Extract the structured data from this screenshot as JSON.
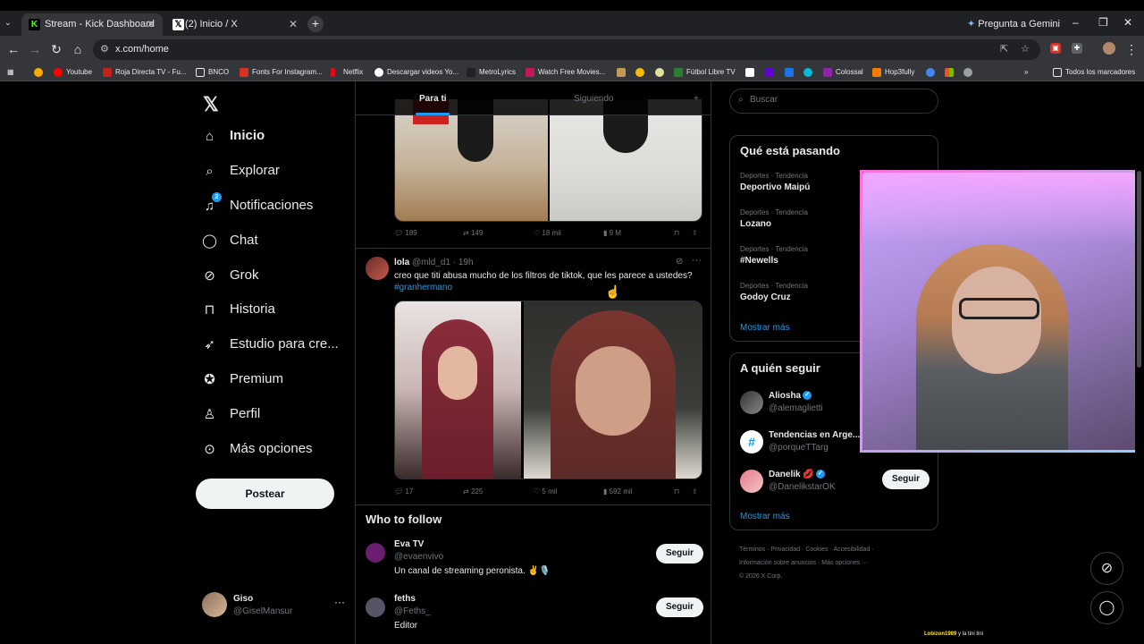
{
  "browser": {
    "tab_menu_icon": "chevron-down-icon",
    "tabs": [
      {
        "title": "Stream - Kick Dashboard",
        "icon": "K",
        "icon_color": "#53fc18",
        "close": "✕"
      },
      {
        "title": "(2) Inicio / X",
        "icon": "𝕏",
        "icon_color": "#000000",
        "close": "✕"
      }
    ],
    "new_tab": "+",
    "gemini": "Pregunta a Gemini",
    "window_controls": [
      "–",
      "❐",
      "✕"
    ],
    "url": "x.com/home",
    "bookmarks": [
      "Youtube",
      "Roja Directa TV - Fu...",
      "BNCO",
      "Fonts For Instagram...",
      "Netflix",
      "Descargar videos Yo...",
      "MetroLyrics",
      "Watch Free Movies...",
      "Fútbol Libre TV",
      "Colossal",
      "Hop3fully"
    ],
    "bookmarks_more": "»",
    "all_bookmarks": "Todos los marcadores"
  },
  "nav": {
    "logo": "𝕏",
    "items": [
      {
        "label": "Inicio",
        "icon": "home-icon"
      },
      {
        "label": "Explorar",
        "icon": "search-icon"
      },
      {
        "label": "Notificaciones",
        "icon": "bell-icon",
        "badge": "2"
      },
      {
        "label": "Chat",
        "icon": "chat-icon"
      },
      {
        "label": "Grok",
        "icon": "grok-icon"
      },
      {
        "label": "Historia",
        "icon": "bookmark-icon"
      },
      {
        "label": "Estudio para cre...",
        "icon": "rocket-icon"
      },
      {
        "label": "Premium",
        "icon": "verified-icon"
      },
      {
        "label": "Perfil",
        "icon": "person-icon"
      },
      {
        "label": "Más opciones",
        "icon": "more-circle-icon"
      }
    ],
    "post_button": "Postear",
    "account": {
      "name": "Giso",
      "handle": "@GiselMansur",
      "more": "···"
    }
  },
  "timeline": {
    "tabs": {
      "for_you": "Para ti",
      "following": "Siguiendo",
      "plus": "+"
    },
    "tweet1": {
      "replies": "189",
      "retweets": "149",
      "likes": "18 mil",
      "views": "9 M"
    },
    "tweet2": {
      "name": "lola",
      "handle": "@mld_d1",
      "time": "· 19h",
      "text": "creo que titi abusa mucho de los filtros de tiktok, que les parece a ustedes?",
      "hashtag": "#granhermano",
      "replies": "17",
      "retweets": "225",
      "likes": "5 mil",
      "views": "592 mil"
    },
    "who_to_follow": {
      "title": "Who to follow",
      "users": [
        {
          "name": "Eva TV",
          "handle": "@evaenvivo",
          "bio": "Un canal de streaming peronista. ✌️🎙️",
          "button": "Seguir"
        },
        {
          "name": "feths",
          "handle": "@Feths_",
          "bio": "Editor",
          "button": "Seguir"
        }
      ]
    }
  },
  "right": {
    "search_placeholder": "Buscar",
    "trending": {
      "title": "Qué está pasando",
      "items": [
        {
          "meta": "Deportes · Tendencia",
          "name": "Deportivo Maipú"
        },
        {
          "meta": "Deportes · Tendencia",
          "name": "Lozano"
        },
        {
          "meta": "Deportes · Tendencia",
          "name": "#Newells"
        },
        {
          "meta": "Deportes · Tendencia",
          "name": "Godoy Cruz"
        }
      ],
      "show_more": "Mostrar más"
    },
    "who_follow": {
      "title": "A quién seguir",
      "users": [
        {
          "name": "Aliosha",
          "handle": "@alemaglietti",
          "verified": true
        },
        {
          "name": "Tendencias en Arge...",
          "handle": "@porqueTTarg",
          "verified": false
        },
        {
          "name": "Danelik 💋",
          "handle": "@DanelikstarOK",
          "verified": true,
          "button": "Seguir"
        }
      ],
      "show_more": "Mostrar más"
    },
    "footer": [
      "Términos",
      "Privacidad",
      "Cookies",
      "Accesibilidad",
      "Información sobre anuncios",
      "Más opciones ···",
      "© 2026 X Corp."
    ]
  },
  "overlay": {
    "chat_user": "Lobizon1989",
    "chat_message": "y la tini tini"
  },
  "colors": {
    "accent": "#1d9bf0",
    "background": "#000000",
    "border": "#2f3336",
    "muted": "#71767b"
  }
}
